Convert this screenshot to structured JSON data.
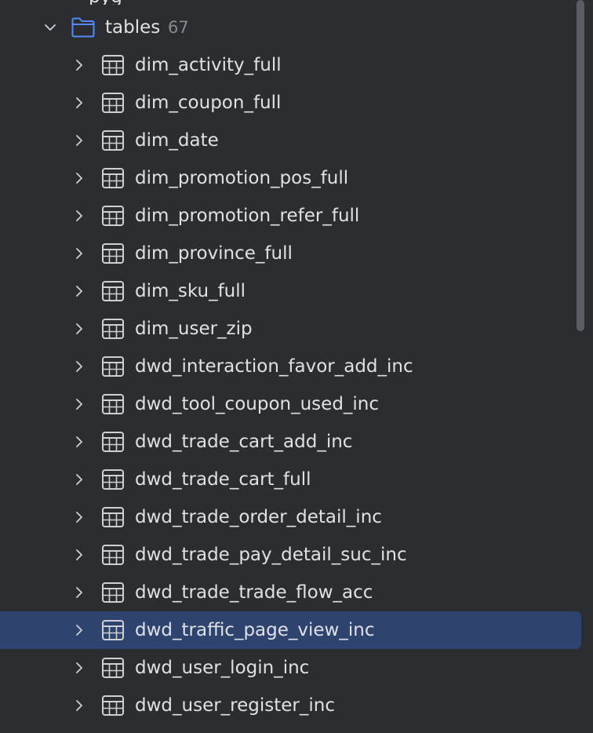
{
  "tree": {
    "clipped_label": "pyg",
    "folder": {
      "label": "tables",
      "count": "67"
    },
    "tables": [
      {
        "label": "dim_activity_full"
      },
      {
        "label": "dim_coupon_full"
      },
      {
        "label": "dim_date"
      },
      {
        "label": "dim_promotion_pos_full"
      },
      {
        "label": "dim_promotion_refer_full"
      },
      {
        "label": "dim_province_full"
      },
      {
        "label": "dim_sku_full"
      },
      {
        "label": "dim_user_zip"
      },
      {
        "label": "dwd_interaction_favor_add_inc"
      },
      {
        "label": "dwd_tool_coupon_used_inc"
      },
      {
        "label": "dwd_trade_cart_add_inc"
      },
      {
        "label": "dwd_trade_cart_full"
      },
      {
        "label": "dwd_trade_order_detail_inc"
      },
      {
        "label": "dwd_trade_pay_detail_suc_inc"
      },
      {
        "label": "dwd_trade_trade_flow_acc"
      },
      {
        "label": "dwd_traffic_page_view_inc",
        "selected": true
      },
      {
        "label": "dwd_user_login_inc"
      },
      {
        "label": "dwd_user_register_inc"
      }
    ]
  },
  "colors": {
    "background": "#2b2d30",
    "selection": "#2e436e",
    "text": "#dfe1e5",
    "muted": "#868a91",
    "folder_icon": "#548af7",
    "table_icon": "#ced0d6"
  }
}
